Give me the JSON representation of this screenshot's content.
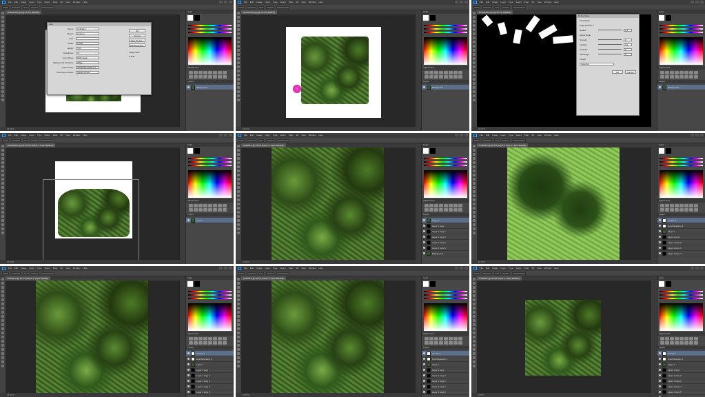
{
  "menu": [
    "File",
    "Edit",
    "Image",
    "Layer",
    "Type",
    "Select",
    "Filter",
    "3D",
    "View",
    "Window",
    "Help"
  ],
  "panel_tabs": {
    "color": "Color",
    "adjustments": "Adjustments",
    "layers": "Layers"
  },
  "dialog_new": {
    "title": "New",
    "fields": [
      {
        "label": "Name:",
        "value": "Untitled-1"
      },
      {
        "label": "Preset:",
        "value": "Custom"
      },
      {
        "label": "Size:",
        "value": ""
      },
      {
        "label": "Width:",
        "value": "1,048"
      },
      {
        "label": "Height:",
        "value": "720"
      },
      {
        "label": "Resolution:",
        "value": "72"
      },
      {
        "label": "Color Mode:",
        "value": "RGB Color"
      },
      {
        "label": "Background Contents:",
        "value": "White"
      },
      {
        "label": "Color Profile:",
        "value": "sRGB IEC61966-2.1"
      },
      {
        "label": "Pixel Aspect Ratio:",
        "value": "Square Pixels"
      }
    ],
    "buttons": [
      "OK",
      "Cancel",
      "Save Preset...",
      "Delete Preset..."
    ],
    "image_size_label": "Image Size:",
    "image_size_value": "2.16M"
  },
  "dialog_refine": {
    "title": "Refine Edge",
    "sections": [
      "View Mode",
      "Edge Detection",
      "Adjust Edge",
      "Output"
    ],
    "params": [
      {
        "label": "Radius:",
        "value": "2.4"
      },
      {
        "label": "Smooth:",
        "value": "0"
      },
      {
        "label": "Feather:",
        "value": "0.0"
      },
      {
        "label": "Contrast:",
        "value": "0"
      },
      {
        "label": "Shift Edge:",
        "value": "0"
      }
    ],
    "output_to": "Selection",
    "buttons": [
      "OK",
      "Cancel"
    ]
  },
  "tiles": [
    {
      "name": "tile-new-document",
      "tab": "GrassPhoto.jpg @ 16.7% (RGB/8)",
      "layers": [
        "Background"
      ],
      "status": "16.67%"
    },
    {
      "name": "tile-grass-selection",
      "tab": "GrassPhoto.jpg @ 16.7% (RGB/8)",
      "layers": [
        "Background"
      ],
      "status": "16.67%"
    },
    {
      "name": "tile-refine-edge",
      "tab": "GrassPhoto.jpg @ 16.7% (RGB/8)",
      "layers": [
        "Background"
      ],
      "status": "16.67%"
    },
    {
      "name": "tile-transform-grass",
      "tab": "GrassPhoto.jpg @ 16.7% (Layer 1, Layer Mask/8)",
      "layers": [
        "Layer 1"
      ],
      "status": "33.33%"
    },
    {
      "name": "tile-tiled-grass",
      "tab": "Untitled-1 @ 16.7% (Layer 1, Layer Mask/8)",
      "layers": [
        "Layer 1",
        "Layer 1 copy",
        "Layer 1 copy 2",
        "Layer 1 copy 3",
        "Layer 1 copy 4",
        "Layer 1 copy 5",
        "Background"
      ],
      "status": "16.67%"
    },
    {
      "name": "tile-light-grass",
      "tab": "Untitled-1 @ 16.7% (Layer 1 copy 4, Layer Mask/8)",
      "layers": [
        "Curves 1",
        "Hue/Saturation 1",
        "Layer 1",
        "Layer 1 copy",
        "Layer 1 copy 2",
        "Layer 1 copy 3",
        "Layer 1 copy 4"
      ],
      "status": "16.67%"
    },
    {
      "name": "tile-grass-full-1",
      "tab": "Untitled-1 @ 16.7% (Layer 1, Layer Mask/8)",
      "layers": [
        "Curves 1",
        "Hue/Saturation 1",
        "Layer 1",
        "Layer 1 copy",
        "Layer 1 copy 2",
        "Layer 1 copy 3",
        "Layer 1 copy 4",
        "Layer 1 copy 5"
      ],
      "status": "16.67%"
    },
    {
      "name": "tile-grass-full-2",
      "tab": "Untitled-1 @ 16.7% (Layer 1, Layer Mask/8)",
      "layers": [
        "Curves 1",
        "Hue/Saturation 1",
        "Layer 1",
        "Layer 1 copy",
        "Layer 1 copy 2",
        "Layer 1 copy 3",
        "Layer 1 copy 4",
        "Layer 1 copy 5"
      ],
      "status": "16.67%"
    },
    {
      "name": "tile-grass-final",
      "tab": "Untitled-1 @ 16.7% (Layer 1, Layer Mask/8)",
      "layers": [
        "Curves 1",
        "Hue/Saturation 1",
        "Layer 1",
        "Layer 1 copy",
        "Layer 1 copy 2",
        "Layer 1 copy 3",
        "Layer 1 copy 4",
        "Layer 1 copy 5",
        "Background"
      ],
      "status": "8.33%"
    }
  ]
}
